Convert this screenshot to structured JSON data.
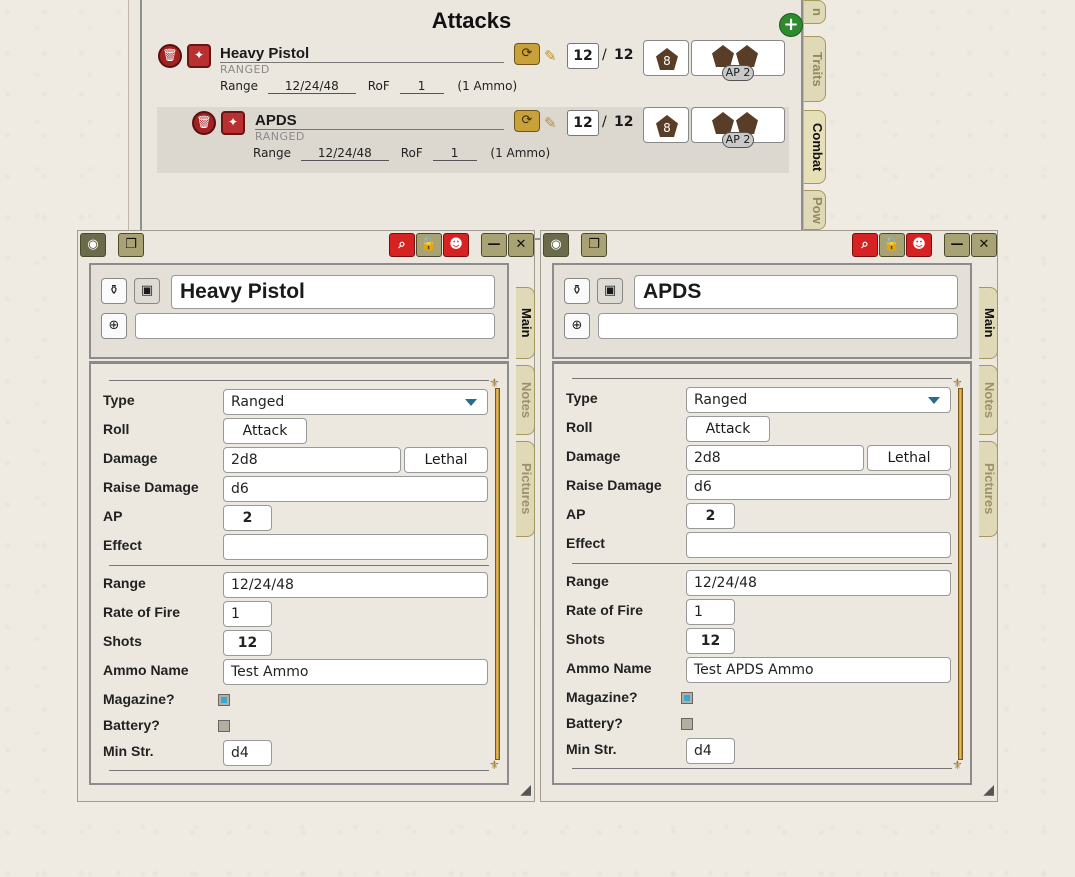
{
  "sheet": {
    "title": "Attacks",
    "tabs": [
      "n",
      "Traits",
      "Combat",
      "Pow"
    ],
    "attacks": [
      {
        "name": "Heavy Pistol",
        "type": "RANGED",
        "range_label": "Range",
        "range": "12/24/48",
        "rof_label": "RoF",
        "rof": "1",
        "ammo": "(1 Ammo)",
        "shots": "12",
        "sep": "/",
        "max": "12",
        "die": "8",
        "ap": "AP 2"
      },
      {
        "name": "APDS",
        "type": "RANGED",
        "range_label": "Range",
        "range": "12/24/48",
        "rof_label": "RoF",
        "rof": "1",
        "ammo": "(1 Ammo)",
        "shots": "12",
        "sep": "/",
        "max": "12",
        "die": "8",
        "ap": "AP 2"
      }
    ]
  },
  "windows": [
    {
      "name": "Heavy Pistol",
      "tabs": [
        "Main",
        "Notes",
        "Pictures"
      ],
      "fields": {
        "type_label": "Type",
        "type": "Ranged",
        "roll_label": "Roll",
        "roll": "Attack",
        "damage_label": "Damage",
        "damage": "2d8",
        "damage_kind": "Lethal",
        "raise_label": "Raise Damage",
        "raise": "d6",
        "ap_label": "AP",
        "ap": "2",
        "effect_label": "Effect",
        "effect": "",
        "range_label": "Range",
        "range": "12/24/48",
        "rof_label": "Rate of Fire",
        "rof": "1",
        "shots_label": "Shots",
        "shots": "12",
        "ammo_label": "Ammo Name",
        "ammo": "Test Ammo",
        "magazine_label": "Magazine?",
        "battery_label": "Battery?",
        "minstr_label": "Min Str.",
        "minstr": "d4"
      }
    },
    {
      "name": "APDS",
      "tabs": [
        "Main",
        "Notes",
        "Pictures"
      ],
      "fields": {
        "type_label": "Type",
        "type": "Ranged",
        "roll_label": "Roll",
        "roll": "Attack",
        "damage_label": "Damage",
        "damage": "2d8",
        "damage_kind": "Lethal",
        "raise_label": "Raise Damage",
        "raise": "d6",
        "ap_label": "AP",
        "ap": "2",
        "effect_label": "Effect",
        "effect": "",
        "range_label": "Range",
        "range": "12/24/48",
        "rof_label": "Rate of Fire",
        "rof": "1",
        "shots_label": "Shots",
        "shots": "12",
        "ammo_label": "Ammo Name",
        "ammo": "Test APDS Ammo",
        "magazine_label": "Magazine?",
        "battery_label": "Battery?",
        "minstr_label": "Min Str.",
        "minstr": "d4"
      }
    }
  ],
  "colors": {
    "accent_red": "#d62222",
    "tab_bg": "#e0d9b8",
    "add_green": "#2f8a2f"
  }
}
